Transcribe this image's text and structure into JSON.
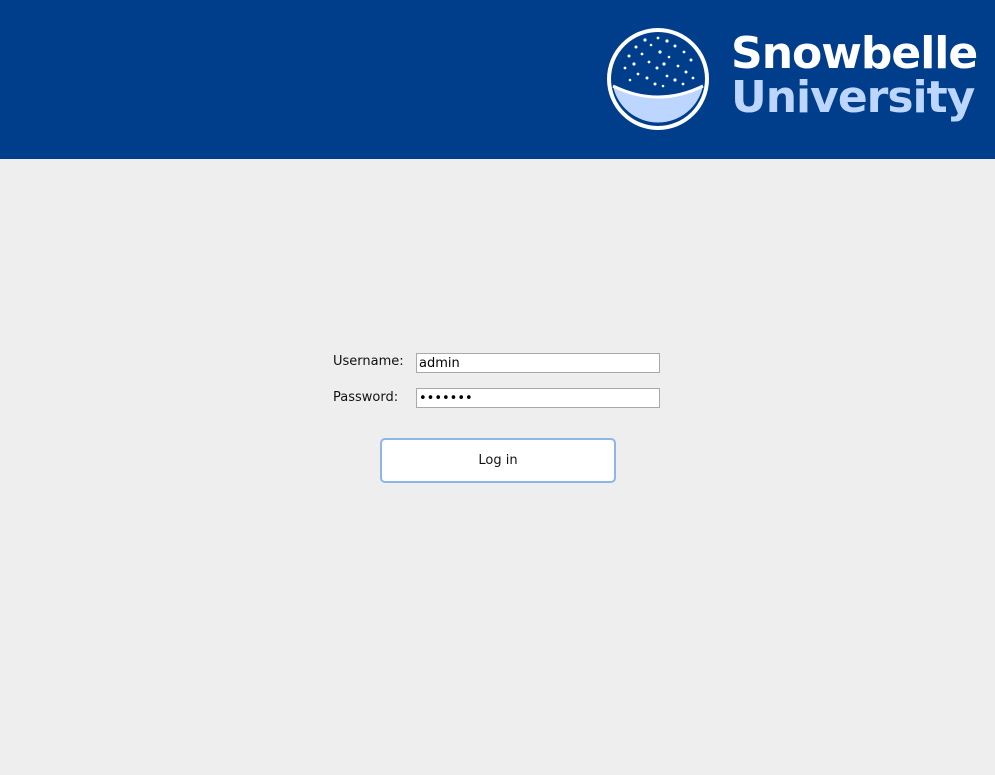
{
  "header": {
    "brand_line1": "Snowbelle",
    "brand_line2": "University",
    "background_color": "#003e8c",
    "brand_line1_color": "#ffffff",
    "brand_line2_color": "#bcd6ff",
    "logo_icon": "snow-globe-icon"
  },
  "login_form": {
    "username_label": "Username:",
    "username_value": "admin",
    "password_label": "Password:",
    "password_value": "xxxxxxx",
    "submit_label": "Log in",
    "button_border_color": "#8db6e8"
  },
  "page": {
    "background_color": "#eeeeee"
  }
}
